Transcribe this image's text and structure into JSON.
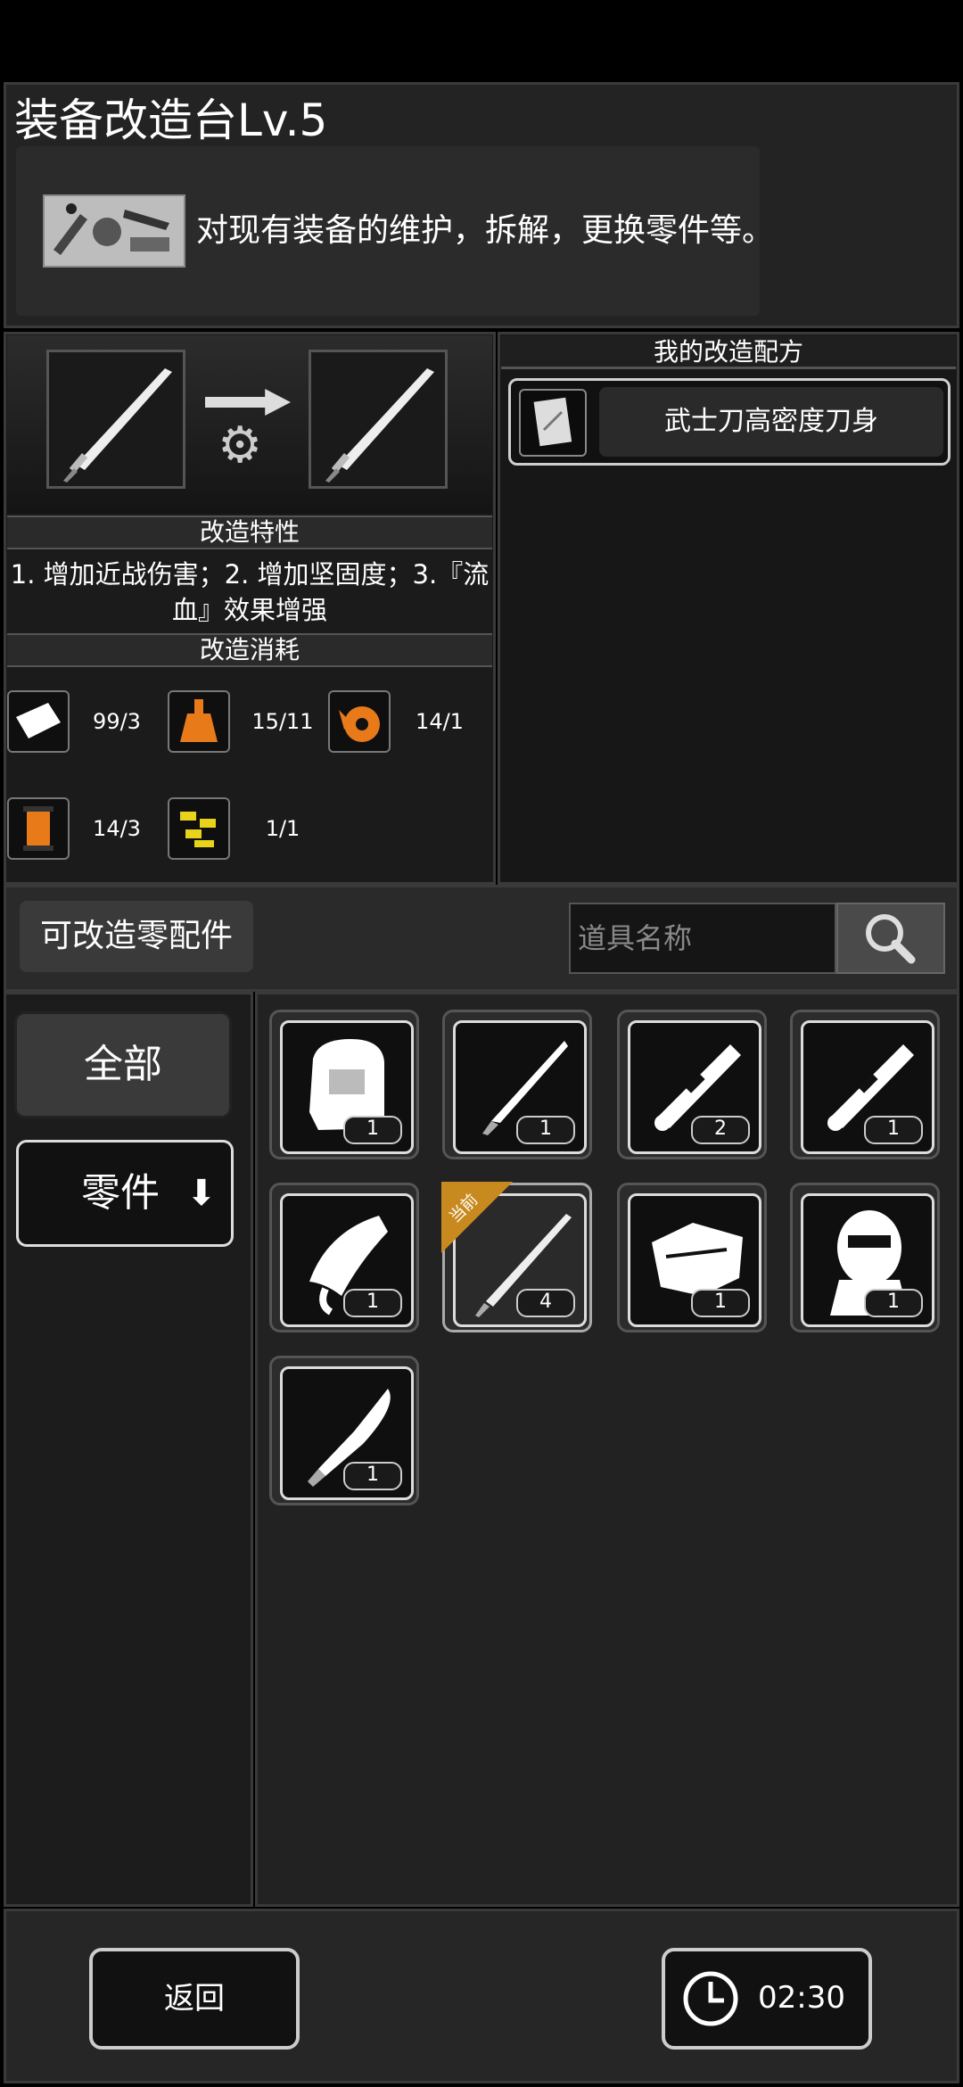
{
  "header": {
    "title": "装备改造台Lv.5",
    "description": "对现有装备的维护，拆解，更换零件等。"
  },
  "upgrade": {
    "traits_header": "改造特性",
    "traits_text": "1. 增加近战伤害；2. 增加坚固度；3.『流血』效果增强",
    "cost_header": "改造消耗",
    "costs": [
      {
        "icon": "paper-icon",
        "amount": "99/3",
        "color": "#ffffff"
      },
      {
        "icon": "flask-icon",
        "amount": "15/11",
        "color": "#e87a1a"
      },
      {
        "icon": "tape-icon",
        "amount": "14/1",
        "color": "#e87a1a"
      },
      {
        "icon": "thread-spool-icon",
        "amount": "14/3",
        "color": "#e87a1a"
      },
      {
        "icon": "parts-icon",
        "amount": "1/1",
        "color": "#e8d21a"
      }
    ]
  },
  "recipes": {
    "header": "我的改造配方",
    "items": [
      {
        "label": "武士刀高密度刀身"
      }
    ]
  },
  "search": {
    "title": "可改造零配件",
    "placeholder": "道具名称"
  },
  "sidebar": {
    "tab_all": "全部",
    "tab_parts": "零件"
  },
  "grid": {
    "items": [
      {
        "icon": "helmet-icon",
        "count": "1",
        "current": false
      },
      {
        "icon": "blade-icon",
        "count": "1",
        "current": false
      },
      {
        "icon": "pipe-icon",
        "count": "2",
        "current": false
      },
      {
        "icon": "pipe-icon",
        "count": "1",
        "current": false
      },
      {
        "icon": "claw-icon",
        "count": "1",
        "current": false
      },
      {
        "icon": "katana-icon",
        "count": "4",
        "current": true,
        "badge": "当前"
      },
      {
        "icon": "armor-icon",
        "count": "1",
        "current": false
      },
      {
        "icon": "mask-icon",
        "count": "1",
        "current": false
      },
      {
        "icon": "machete-icon",
        "count": "1",
        "current": false
      }
    ]
  },
  "footer": {
    "back_label": "返回",
    "timer": "02:30"
  },
  "colors": {
    "accent_orange": "#e87a1a",
    "badge_gold": "#c88a1f"
  }
}
